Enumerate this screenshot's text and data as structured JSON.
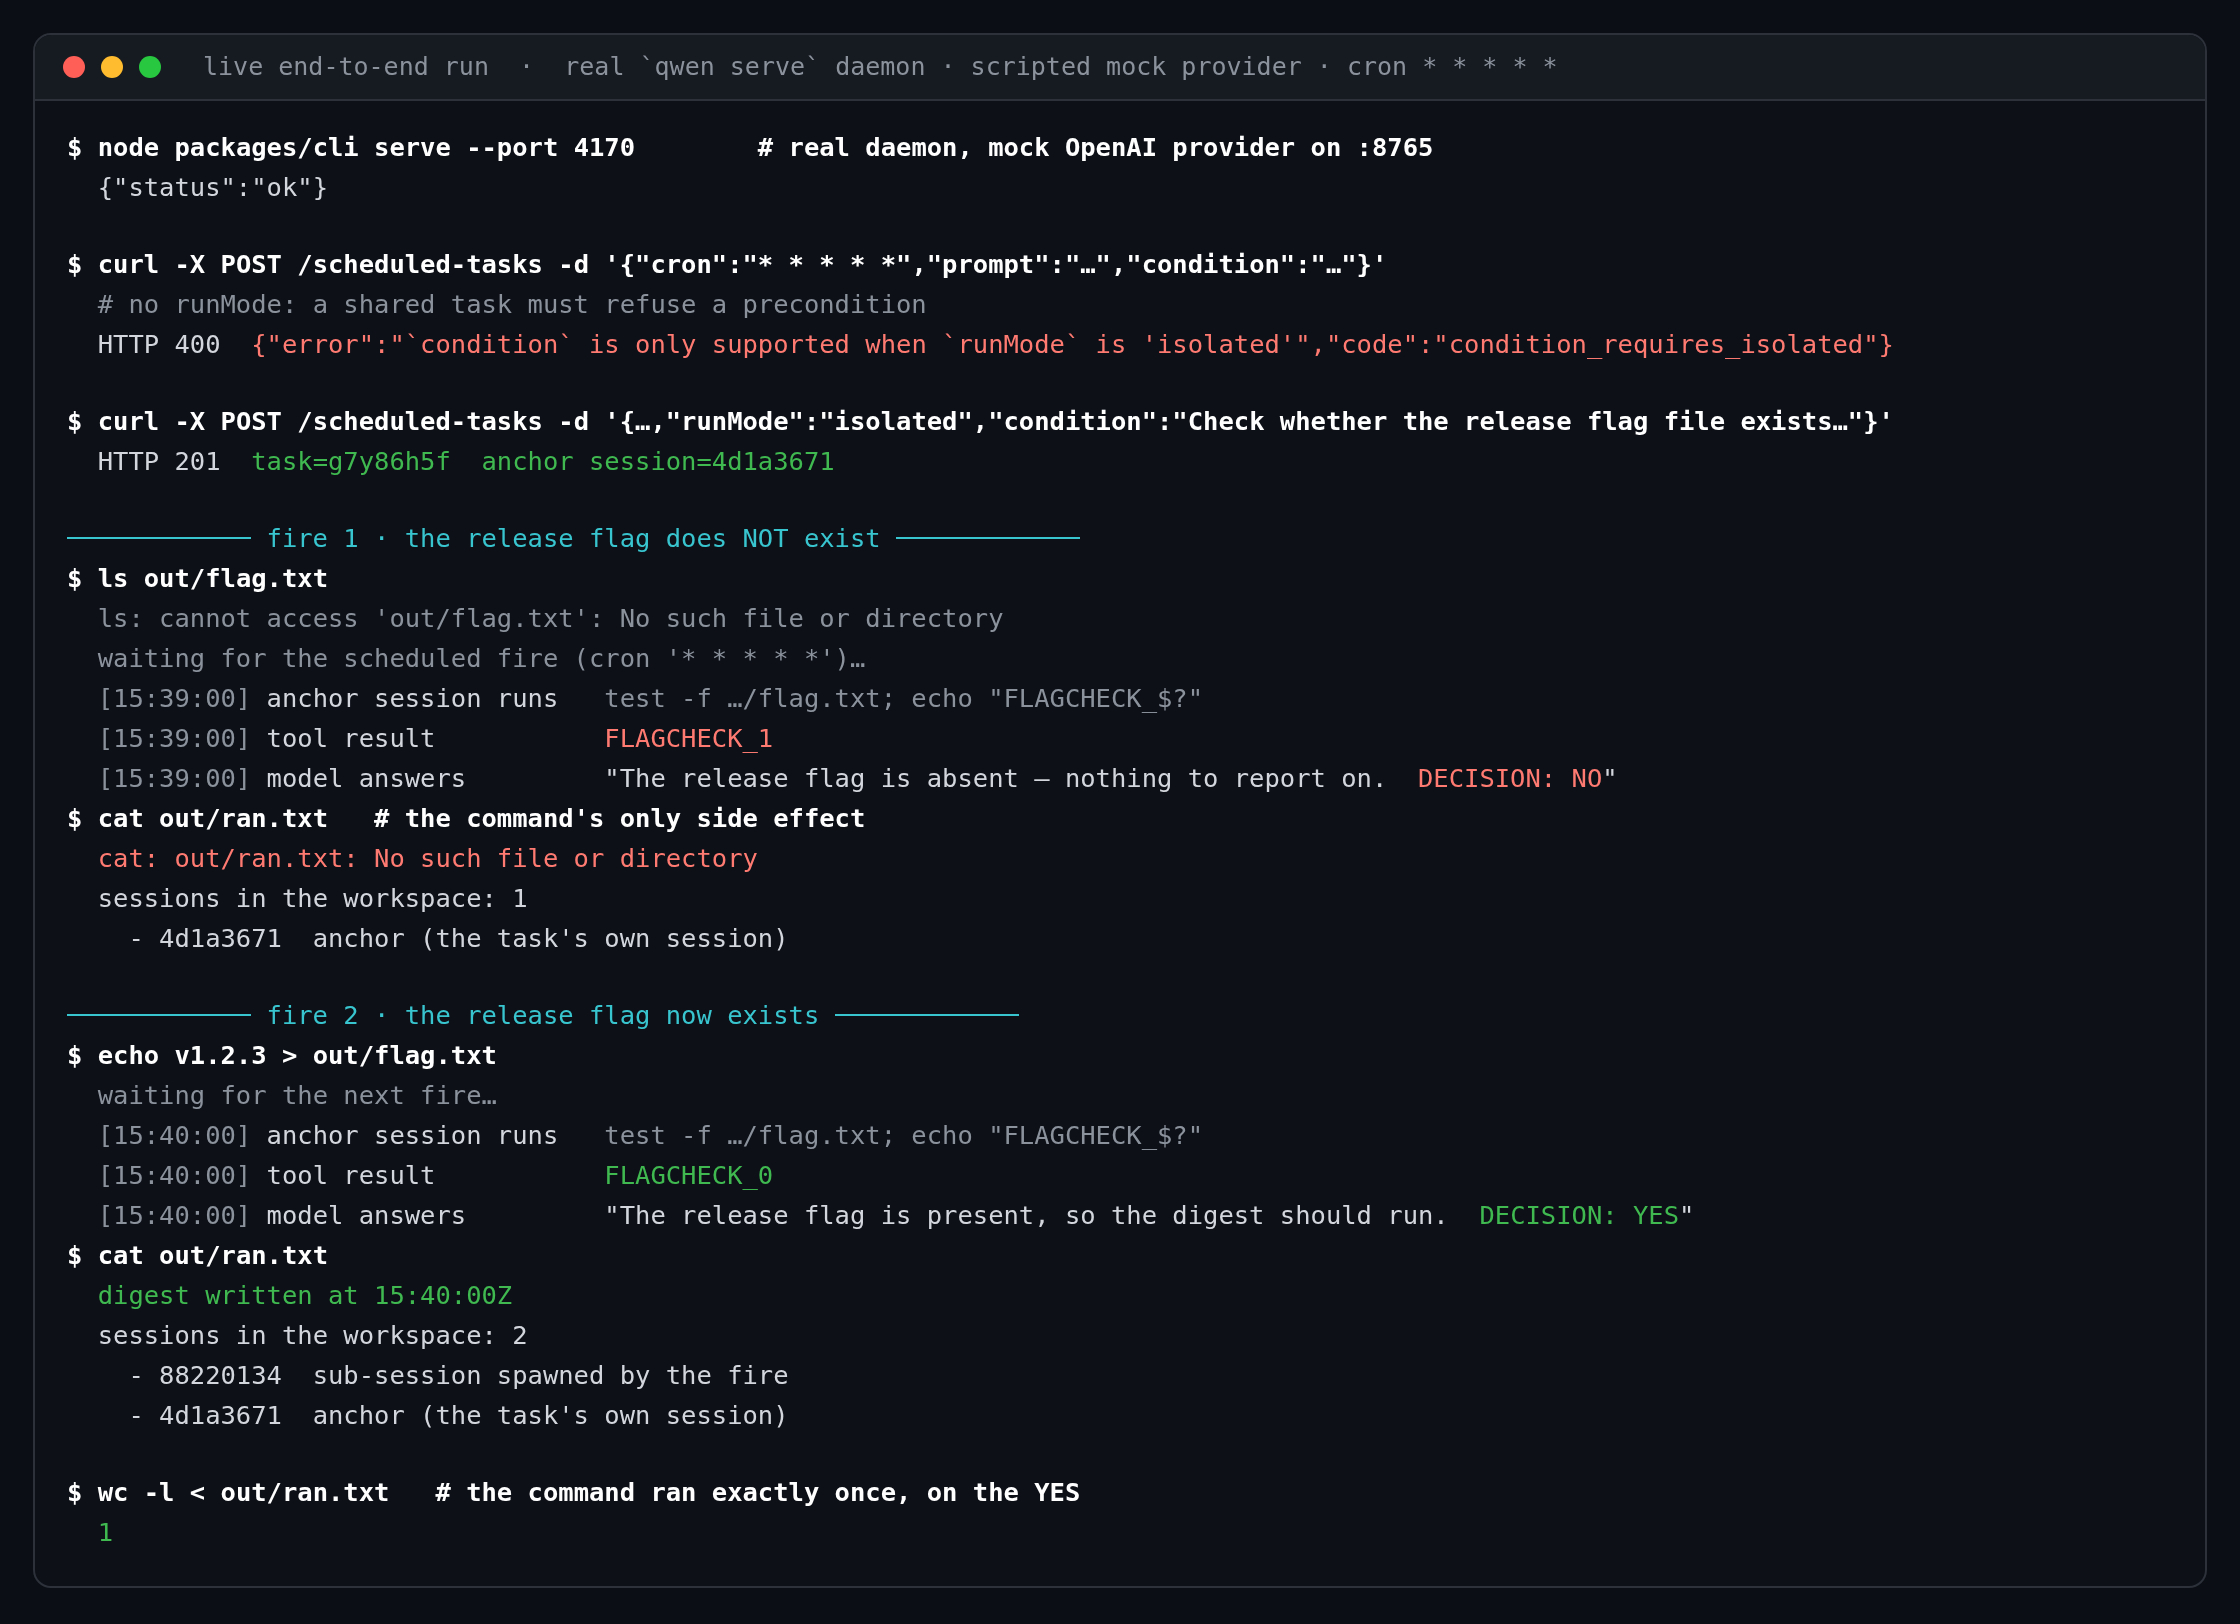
{
  "window": {
    "title": "live end-to-end run  ·  real `qwen serve` daemon · scripted mock provider · cron * * * * *"
  },
  "lines": [
    {
      "kind": "command",
      "text": "$ node packages/cli serve --port 4170        # real daemon, mock OpenAI provider on :8765"
    },
    {
      "kind": "output",
      "parts": [
        {
          "text": "{\"status\":\"ok\"}",
          "kind": "plain"
        }
      ]
    },
    {
      "kind": "blank"
    },
    {
      "kind": "command",
      "text": "$ curl -X POST /scheduled-tasks -d '{\"cron\":\"* * * * *\",\"prompt\":\"…\",\"condition\":\"…\"}'"
    },
    {
      "kind": "output",
      "parts": [
        {
          "text": "# no runMode: a shared task must refuse a precondition",
          "kind": "dim"
        }
      ]
    },
    {
      "kind": "output",
      "parts": [
        {
          "text": "HTTP 400  ",
          "kind": "plain"
        },
        {
          "text": "{\"error\":\"`condition` is only supported when `runMode` is 'isolated'\",\"code\":\"condition_requires_isolated\"}",
          "kind": "error"
        }
      ]
    },
    {
      "kind": "blank"
    },
    {
      "kind": "command",
      "text": "$ curl -X POST /scheduled-tasks -d '{…,\"runMode\":\"isolated\",\"condition\":\"Check whether the release flag file exists…\"}'"
    },
    {
      "kind": "output",
      "parts": [
        {
          "text": "HTTP 201  ",
          "kind": "plain"
        },
        {
          "text": "task=g7y86h5f  anchor session=4d1a3671",
          "kind": "success"
        }
      ]
    },
    {
      "kind": "blank"
    },
    {
      "kind": "rule",
      "text": "fire 1 · the release flag does NOT exist"
    },
    {
      "kind": "command",
      "text": "$ ls out/flag.txt"
    },
    {
      "kind": "output",
      "parts": [
        {
          "text": "ls: cannot access 'out/flag.txt': No such file or directory",
          "kind": "dim"
        }
      ]
    },
    {
      "kind": "output",
      "parts": [
        {
          "text": "waiting for the scheduled fire (cron '* * * * *')…",
          "kind": "dim"
        }
      ]
    },
    {
      "kind": "event",
      "time": "[15:39:00]",
      "label": "anchor session runs",
      "parts": [
        {
          "text": "test -f …/flag.txt; echo \"FLAGCHECK_$?\"",
          "kind": "dim"
        }
      ]
    },
    {
      "kind": "event",
      "time": "[15:39:00]",
      "label": "tool result",
      "parts": [
        {
          "text": "FLAGCHECK_1",
          "kind": "error"
        }
      ]
    },
    {
      "kind": "event",
      "time": "[15:39:00]",
      "label": "model answers",
      "parts": [
        {
          "text": "\"The release flag is absent — nothing to report on.  ",
          "kind": "plain"
        },
        {
          "text": "DECISION: NO",
          "kind": "error"
        },
        {
          "text": "\"",
          "kind": "plain"
        }
      ]
    },
    {
      "kind": "command",
      "text": "$ cat out/ran.txt   # the command's only side effect"
    },
    {
      "kind": "output",
      "parts": [
        {
          "text": "cat: out/ran.txt: No such file or directory",
          "kind": "error"
        }
      ]
    },
    {
      "kind": "output",
      "parts": [
        {
          "text": "sessions in the workspace: 1",
          "kind": "plain"
        }
      ]
    },
    {
      "kind": "item",
      "parts": [
        {
          "text": "- 4d1a3671  anchor (the task's own session)",
          "kind": "plain"
        }
      ]
    },
    {
      "kind": "blank"
    },
    {
      "kind": "rule",
      "text": "fire 2 · the release flag now exists"
    },
    {
      "kind": "command",
      "text": "$ echo v1.2.3 > out/flag.txt"
    },
    {
      "kind": "output",
      "parts": [
        {
          "text": "waiting for the next fire…",
          "kind": "dim"
        }
      ]
    },
    {
      "kind": "event",
      "time": "[15:40:00]",
      "label": "anchor session runs",
      "parts": [
        {
          "text": "test -f …/flag.txt; echo \"FLAGCHECK_$?\"",
          "kind": "dim"
        }
      ]
    },
    {
      "kind": "event",
      "time": "[15:40:00]",
      "label": "tool result",
      "parts": [
        {
          "text": "FLAGCHECK_0",
          "kind": "success"
        }
      ]
    },
    {
      "kind": "event",
      "time": "[15:40:00]",
      "label": "model answers",
      "parts": [
        {
          "text": "\"The release flag is present, so the digest should run.  ",
          "kind": "plain"
        },
        {
          "text": "DECISION: YES",
          "kind": "success"
        },
        {
          "text": "\"",
          "kind": "plain"
        }
      ]
    },
    {
      "kind": "command",
      "text": "$ cat out/ran.txt"
    },
    {
      "kind": "output",
      "parts": [
        {
          "text": "digest written at 15:40:00Z",
          "kind": "success"
        }
      ]
    },
    {
      "kind": "output",
      "parts": [
        {
          "text": "sessions in the workspace: 2",
          "kind": "plain"
        }
      ]
    },
    {
      "kind": "item",
      "parts": [
        {
          "text": "- 88220134  sub-session spawned by the fire",
          "kind": "plain"
        }
      ]
    },
    {
      "kind": "item",
      "parts": [
        {
          "text": "- 4d1a3671  anchor (the task's own session)",
          "kind": "plain"
        }
      ]
    },
    {
      "kind": "blank"
    },
    {
      "kind": "command",
      "text": "$ wc -l < out/ran.txt   # the command ran exactly once, on the YES"
    },
    {
      "kind": "output",
      "parts": [
        {
          "text": "1",
          "kind": "success"
        }
      ]
    }
  ]
}
